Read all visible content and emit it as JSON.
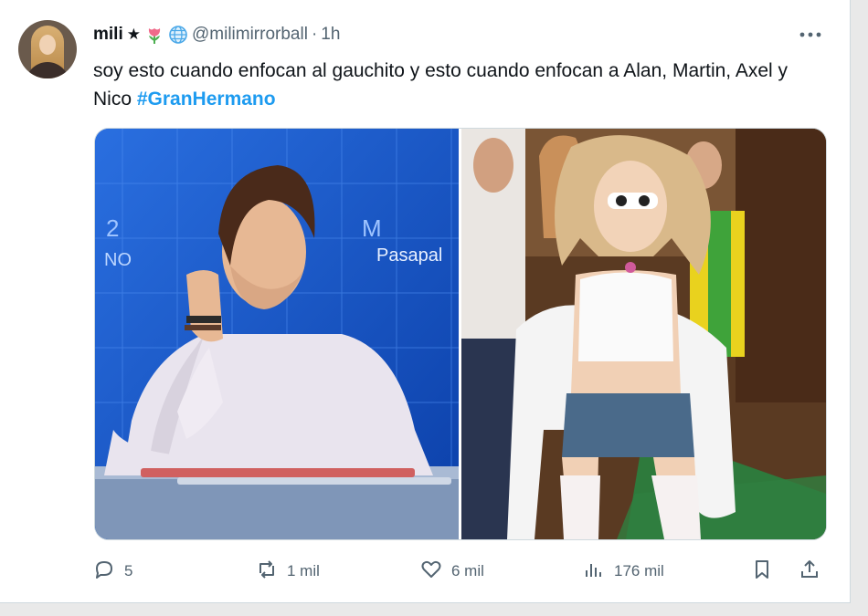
{
  "author": {
    "name": "mili",
    "star": "★",
    "handle": "@milimirrorball",
    "separator": "·",
    "time": "1h"
  },
  "icons": {
    "badge1": "tulip-icon",
    "badge2": "globe-icon",
    "more": "more-dots-icon"
  },
  "tweet": {
    "text": "soy esto cuando enfocan al gauchito y esto cuando enfocan a Alan, Martin, Axel y Nico",
    "hashtag": "#GranHermano"
  },
  "media": {
    "overlay_text": "Pasapal"
  },
  "actions": {
    "replies": "5",
    "retweets": "1 mil",
    "likes": "6 mil",
    "views": "176 mil"
  },
  "colors": {
    "accent": "#1d9bf0",
    "muted": "#536471",
    "text": "#0f1419"
  }
}
